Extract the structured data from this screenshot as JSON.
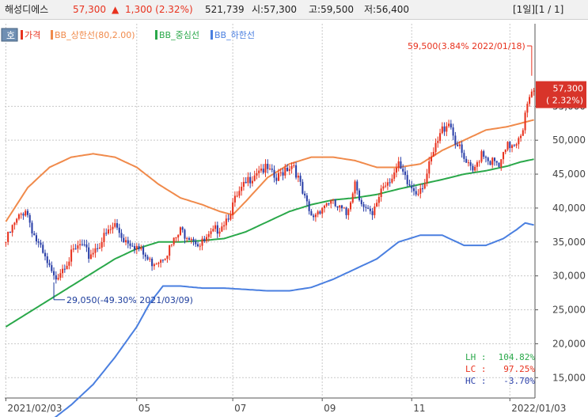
{
  "header": {
    "stock_name": "해성디에스",
    "price": "57,300",
    "change_arrow": "▲",
    "change": "1,300 (2.32%)",
    "volume": "521,739",
    "open": "시:57,300",
    "high": "고:59,500",
    "low": "저:56,400",
    "page_info": "[1일][1 / 1]"
  },
  "toolbar": {
    "mode_button": "호",
    "legend_items": [
      "가격",
      "BB_상한선(80,2.00)",
      "BB_중심선",
      "BB_하한선"
    ]
  },
  "colors": {
    "up": "#e8321e",
    "down": "#2a3fa8",
    "upper_band": "#f08a4b",
    "middle_band": "#2aa84a",
    "lower_band": "#4a7fe0",
    "price_badge": "#d8342a",
    "grid": "#c8c8c8",
    "annotation_high": "#e8321e",
    "annotation_low": "#1c3c9c"
  },
  "chart_data": {
    "type": "line",
    "y_axis_side": "right",
    "ylim": [
      12000,
      66000
    ],
    "y_ticks": [
      15000,
      20000,
      25000,
      30000,
      35000,
      40000,
      45000,
      50000,
      55000
    ],
    "y_tick_labels": [
      "15,000",
      "20,000",
      "25,000",
      "30,000",
      "35,000",
      "40,000",
      "45,000",
      "50,000",
      "55,000"
    ],
    "x_tick_labels": [
      {
        "index": 0,
        "label": "2021/02/03"
      },
      {
        "index": 60,
        "label": "05"
      },
      {
        "index": 104,
        "label": "07"
      },
      {
        "index": 145,
        "label": "09"
      },
      {
        "index": 186,
        "label": "11"
      },
      {
        "index": 231,
        "label": "2022/01/03"
      }
    ],
    "x_count": 243,
    "price_badge": {
      "value": 57300,
      "line1": "57,300",
      "line2": "( 2.32%)"
    },
    "high_annotation": {
      "index": 241,
      "value": 59500,
      "text": "59,500(3.84% 2022/01/18)"
    },
    "low_annotation": {
      "index": 22,
      "value": 29050,
      "text": "29,050(-49.30% 2021/03/09)"
    },
    "stats": {
      "LH": "104.82%",
      "LC": "97.25%",
      "HC": "-3.70%"
    },
    "series": [
      {
        "name": "가격",
        "key": "close",
        "anchors": [
          [
            0,
            35000
          ],
          [
            3,
            37000
          ],
          [
            9,
            40000
          ],
          [
            13,
            36000
          ],
          [
            17,
            33000
          ],
          [
            22,
            29500
          ],
          [
            26,
            31500
          ],
          [
            30,
            33000
          ],
          [
            34,
            34500
          ],
          [
            38,
            33000
          ],
          [
            42,
            34500
          ],
          [
            46,
            36000
          ],
          [
            50,
            37500
          ],
          [
            54,
            35500
          ],
          [
            58,
            35000
          ],
          [
            62,
            33500
          ],
          [
            66,
            32000
          ],
          [
            70,
            32500
          ],
          [
            75,
            34000
          ],
          [
            80,
            36500
          ],
          [
            85,
            36000
          ],
          [
            89,
            34500
          ],
          [
            93,
            35500
          ],
          [
            97,
            37000
          ],
          [
            101,
            38500
          ],
          [
            105,
            41000
          ],
          [
            109,
            43000
          ],
          [
            112,
            44500
          ],
          [
            116,
            46000
          ],
          [
            120,
            45500
          ],
          [
            124,
            44000
          ],
          [
            128,
            46000
          ],
          [
            132,
            46500
          ],
          [
            136,
            42000
          ],
          [
            140,
            38500
          ],
          [
            144,
            40000
          ],
          [
            148,
            41000
          ],
          [
            152,
            40000
          ],
          [
            156,
            39000
          ],
          [
            160,
            44000
          ],
          [
            164,
            40000
          ],
          [
            168,
            38500
          ],
          [
            172,
            43000
          ],
          [
            176,
            44500
          ],
          [
            180,
            46000
          ],
          [
            184,
            43500
          ],
          [
            188,
            42500
          ],
          [
            192,
            44000
          ],
          [
            196,
            48000
          ],
          [
            200,
            51500
          ],
          [
            203,
            53000
          ],
          [
            206,
            50000
          ],
          [
            210,
            47000
          ],
          [
            214,
            45000
          ],
          [
            218,
            48500
          ],
          [
            222,
            47000
          ],
          [
            226,
            46000
          ],
          [
            230,
            49000
          ],
          [
            234,
            50000
          ],
          [
            237,
            52000
          ],
          [
            239,
            55000
          ],
          [
            242,
            57300
          ]
        ]
      },
      {
        "name": "BB_상한선(80,2.00)",
        "key": "upper",
        "anchors": [
          [
            0,
            38000
          ],
          [
            10,
            43000
          ],
          [
            20,
            46000
          ],
          [
            30,
            47500
          ],
          [
            40,
            48000
          ],
          [
            50,
            47500
          ],
          [
            60,
            46000
          ],
          [
            70,
            43500
          ],
          [
            80,
            41500
          ],
          [
            90,
            40500
          ],
          [
            98,
            39500
          ],
          [
            104,
            39000
          ],
          [
            110,
            41000
          ],
          [
            120,
            44500
          ],
          [
            130,
            46500
          ],
          [
            140,
            47500
          ],
          [
            150,
            47500
          ],
          [
            160,
            47000
          ],
          [
            170,
            46000
          ],
          [
            180,
            46000
          ],
          [
            190,
            46500
          ],
          [
            200,
            48500
          ],
          [
            210,
            50000
          ],
          [
            220,
            51500
          ],
          [
            230,
            52000
          ],
          [
            236,
            52500
          ],
          [
            242,
            53000
          ]
        ]
      },
      {
        "name": "BB_중심선",
        "key": "middle",
        "anchors": [
          [
            0,
            22500
          ],
          [
            10,
            24500
          ],
          [
            20,
            26500
          ],
          [
            30,
            28500
          ],
          [
            40,
            30500
          ],
          [
            50,
            32500
          ],
          [
            60,
            34000
          ],
          [
            70,
            35000
          ],
          [
            80,
            35000
          ],
          [
            90,
            35200
          ],
          [
            100,
            35500
          ],
          [
            110,
            36500
          ],
          [
            120,
            38000
          ],
          [
            130,
            39500
          ],
          [
            140,
            40500
          ],
          [
            150,
            41200
          ],
          [
            160,
            41500
          ],
          [
            170,
            42000
          ],
          [
            180,
            42800
          ],
          [
            190,
            43500
          ],
          [
            200,
            44200
          ],
          [
            210,
            45000
          ],
          [
            220,
            45500
          ],
          [
            230,
            46200
          ],
          [
            236,
            46800
          ],
          [
            242,
            47200
          ]
        ]
      },
      {
        "name": "BB_하한선",
        "key": "lower",
        "anchors": [
          [
            0,
            7000
          ],
          [
            8,
            6800
          ],
          [
            14,
            7200
          ],
          [
            20,
            8500
          ],
          [
            30,
            11000
          ],
          [
            40,
            14000
          ],
          [
            50,
            18000
          ],
          [
            60,
            22500
          ],
          [
            66,
            26000
          ],
          [
            72,
            28500
          ],
          [
            80,
            28500
          ],
          [
            90,
            28200
          ],
          [
            100,
            28200
          ],
          [
            110,
            28000
          ],
          [
            120,
            27800
          ],
          [
            130,
            27800
          ],
          [
            140,
            28300
          ],
          [
            150,
            29500
          ],
          [
            160,
            31000
          ],
          [
            170,
            32500
          ],
          [
            180,
            35000
          ],
          [
            190,
            36000
          ],
          [
            200,
            36000
          ],
          [
            210,
            34500
          ],
          [
            220,
            34500
          ],
          [
            228,
            35500
          ],
          [
            234,
            36800
          ],
          [
            238,
            37800
          ],
          [
            242,
            37500
          ]
        ]
      }
    ]
  }
}
